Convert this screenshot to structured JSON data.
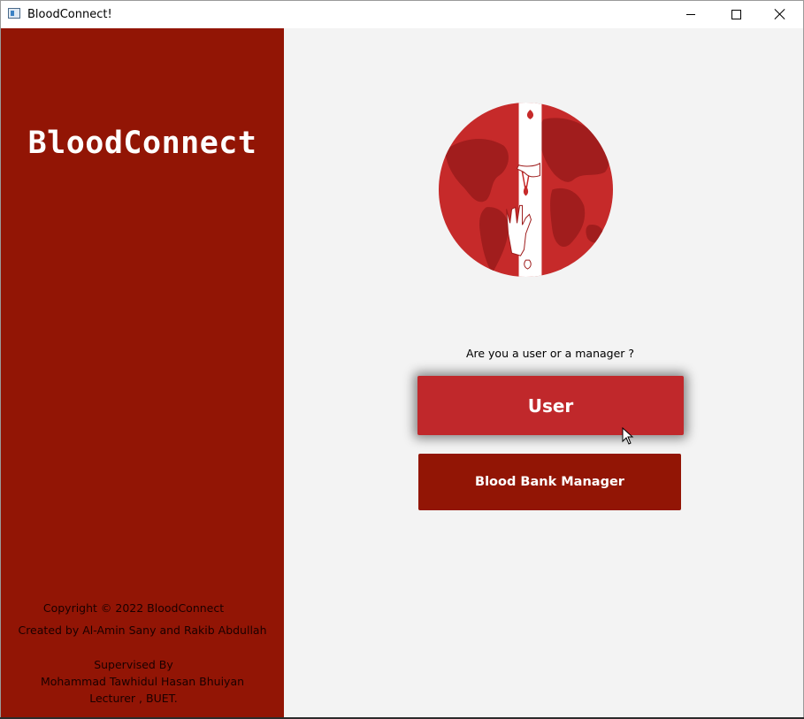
{
  "window": {
    "title": "BloodConnect!",
    "icon": "app-window-icon",
    "controls": [
      "minimize-icon",
      "maximize-icon",
      "close-icon"
    ]
  },
  "sidebar": {
    "brand": "BloodConnect",
    "copyright": "Copyright © 2022 BloodConnect",
    "created_by": "Created by Al-Amin Sany and Rakib Abdullah",
    "supervised_label": "Supervised By",
    "supervisor_name": "Mohammad Tawhidul Hasan Bhuiyan",
    "supervisor_title": "Lecturer , BUET."
  },
  "main": {
    "logo_icon": "blood-donation-globe-icon",
    "question": "Are you a user or a manager ?",
    "user_button": "User",
    "manager_button": "Blood Bank Manager"
  },
  "colors": {
    "sidebar_bg": "#921505",
    "main_bg": "#f3f3f3",
    "user_button": "#c0282b",
    "manager_button": "#921505",
    "globe": "#c62a2a"
  }
}
